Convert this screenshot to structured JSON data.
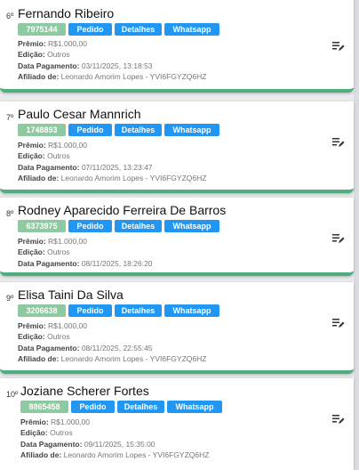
{
  "labels": {
    "premio": "Prêmio:",
    "edicao": "Edição:",
    "data_pagamento": "Data Pagamento:",
    "afiliado": "Afiliado de:"
  },
  "buttons": {
    "pedido": "Pedido",
    "detalhes": "Detalhes",
    "whatsapp": "Whatsapp"
  },
  "icons": {
    "edit": "edit-list-icon"
  },
  "colors": {
    "accent": "#4caf7d",
    "button": "#2196f3",
    "code_badge": "#8ec9a1"
  },
  "cards": [
    {
      "rank": "6º",
      "name": "Fernando Ribeiro",
      "code": "7975144",
      "premio": "R$1.000,00",
      "edicao": "Outros",
      "data_pagamento": "03/11/2025, 13:18:53",
      "afiliado": "Leonardo Amorim Lopes - YVI6FGYZQ6HZ"
    },
    {
      "rank": "7º",
      "name": "Paulo Cesar Mannrich",
      "code": "1748893",
      "premio": "R$1.000,00",
      "edicao": "Outros",
      "data_pagamento": "07/11/2025, 13:23:47",
      "afiliado": "Leonardo Amorim Lopes - YVI6FGYZQ6HZ"
    },
    {
      "rank": "8º",
      "name": "Rodney Aparecido Ferreira De Barros",
      "code": "6373975",
      "premio": "R$1.000,00",
      "edicao": "Outros",
      "data_pagamento": "08/11/2025, 18:26:20",
      "afiliado": ""
    },
    {
      "rank": "9º",
      "name": "Elisa Taini Da Silva",
      "code": "3206638",
      "premio": "R$1.000,00",
      "edicao": "Outros",
      "data_pagamento": "08/11/2025, 22:55:45",
      "afiliado": "Leonardo Amorim Lopes - YVI6FGYZQ6HZ"
    },
    {
      "rank": "10º",
      "name": "Joziane Scherer Fortes",
      "code": "8865458",
      "premio": "R$1.000,00",
      "edicao": "Outros",
      "data_pagamento": "09/11/2025, 15:35:00",
      "afiliado": "Leonardo Amorim Lopes - YVI6FGYZQ6HZ"
    }
  ]
}
